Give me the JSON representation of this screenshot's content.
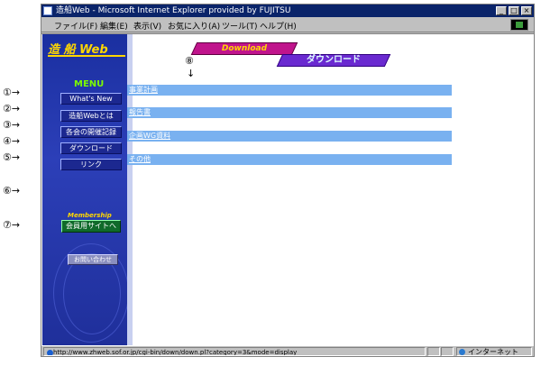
{
  "window": {
    "title": "造船Web - Microsoft Internet Explorer provided by FUJITSU",
    "controls": {
      "minimize": "_",
      "maximize": "□",
      "close": "×"
    }
  },
  "menubar": {
    "items": [
      "ファイル(F)",
      "編集(E)",
      "表示(V)",
      "お気に入り(A)",
      "ツール(T)",
      "ヘルプ(H)"
    ]
  },
  "sidebar": {
    "logo": "造 船 Web",
    "menu_title": "MENU",
    "items": [
      "What's New",
      "造船Webとは",
      "各会の開催記録",
      "ダウンロード",
      "リンク"
    ],
    "membership_label": "Membership",
    "member_button": "会員用サイトへ",
    "inquiry_button": "お問い合わせ"
  },
  "main": {
    "banner_en": "Download",
    "banner_jp": "ダウンロード",
    "categories": [
      "事業計画",
      "報告書",
      "企画WG資料",
      "その他"
    ]
  },
  "callouts": {
    "left": [
      "①→",
      "②→",
      "③→",
      "④→",
      "⑤→",
      "⑥→",
      "⑦→"
    ],
    "main_number": "⑧",
    "main_arrow": "↓"
  },
  "statusbar": {
    "url": "http://www.zhweb.sof.or.jp/cgi-bin/down/down.pl?category=3&mode=display",
    "zone": "インターネット"
  }
}
